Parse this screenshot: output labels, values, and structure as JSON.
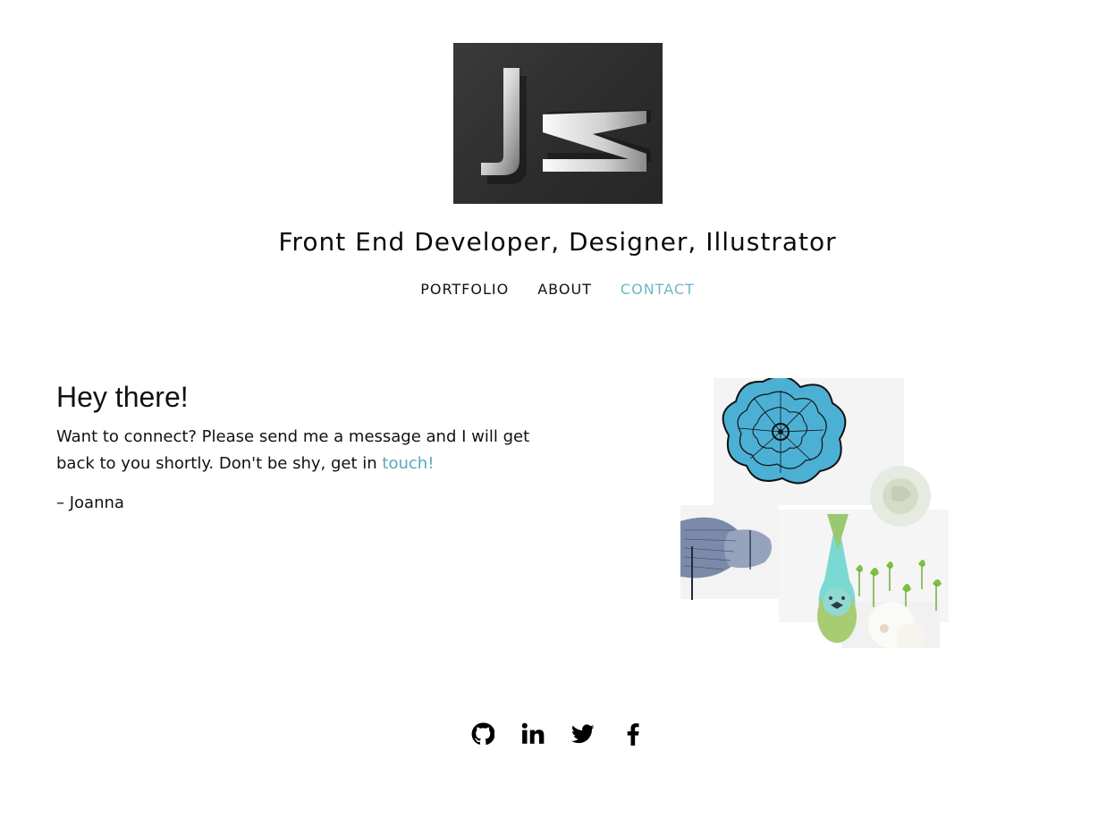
{
  "logo": {
    "letters": "JK",
    "icon": "jk-monogram-logo"
  },
  "header": {
    "tagline": "Front End Developer, Designer, Illustrator"
  },
  "nav": {
    "items": [
      {
        "label": "PORTFOLIO",
        "active": false
      },
      {
        "label": "ABOUT",
        "active": false
      },
      {
        "label": "CONTACT",
        "active": true
      }
    ]
  },
  "contact": {
    "heading": "Hey there!",
    "message_text": "Want to connect? Please send me a message and I will get back to you shortly. Don't be shy, get in ",
    "link_text": "touch!",
    "signature": "– Joanna"
  },
  "illustration": {
    "icon": "flower-bird-illustration"
  },
  "social": {
    "icons": [
      "github-icon",
      "linkedin-icon",
      "twitter-icon",
      "facebook-icon"
    ]
  },
  "colors": {
    "accent": "#6fb6c9",
    "link": "#5aa8bd",
    "text": "#111111",
    "logo_bg": "#2f2f2f"
  }
}
